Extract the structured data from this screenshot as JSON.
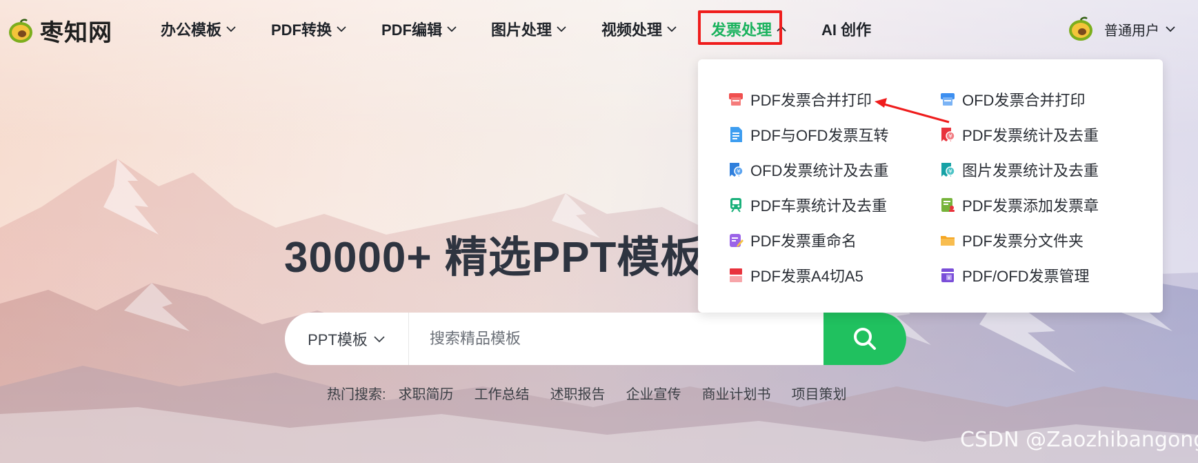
{
  "brand": {
    "name": "枣知网"
  },
  "nav": {
    "items": [
      {
        "label": "办公模板"
      },
      {
        "label": "PDF转换"
      },
      {
        "label": "PDF编辑"
      },
      {
        "label": "图片处理"
      },
      {
        "label": "视频处理"
      },
      {
        "label": "发票处理"
      },
      {
        "label": "AI 创作"
      }
    ]
  },
  "user": {
    "label": "普通用户"
  },
  "dropdown": {
    "left": [
      {
        "label": "PDF发票合并打印",
        "icon": "invoice-print-icon",
        "color": "#f0504f"
      },
      {
        "label": "PDF与OFD发票互转",
        "icon": "invoice-convert-icon",
        "color": "#3d9df0"
      },
      {
        "label": "OFD发票统计及去重",
        "icon": "ofd-dedupe-icon",
        "color": "#2f7fdc"
      },
      {
        "label": "PDF车票统计及去重",
        "icon": "train-ticket-icon",
        "color": "#19b07a"
      },
      {
        "label": "PDF发票重命名",
        "icon": "rename-icon",
        "color": "#9b63e8"
      },
      {
        "label": "PDF发票A4切A5",
        "icon": "a4-cut-icon",
        "color": "#e8323c"
      }
    ],
    "right": [
      {
        "label": "OFD发票合并打印",
        "icon": "ofd-print-icon",
        "color": "#3d8ff0"
      },
      {
        "label": "PDF发票统计及去重",
        "icon": "pdf-dedupe-icon",
        "color": "#e8323c"
      },
      {
        "label": "图片发票统计及去重",
        "icon": "image-dedupe-icon",
        "color": "#16a2a6"
      },
      {
        "label": "PDF发票添加发票章",
        "icon": "stamp-icon",
        "color": "#76b33a"
      },
      {
        "label": "PDF发票分文件夹",
        "icon": "folder-icon",
        "color": "#f5a623"
      },
      {
        "label": "PDF/OFD发票管理",
        "icon": "manage-icon",
        "color": "#7a4ed8"
      }
    ]
  },
  "hero": {
    "title": "30000+ 精选PPT模板",
    "search": {
      "category": "PPT模板",
      "placeholder": "搜索精品模板"
    },
    "hot_label": "热门搜索:",
    "hot_items": [
      "求职简历",
      "工作总结",
      "述职报告",
      "企业宣传",
      "商业计划书",
      "项目策划"
    ]
  },
  "watermark": "CSDN @Zaozhibangong",
  "colors": {
    "accent": "#20c15f",
    "highlight_box": "#ef1c1c",
    "arrow": "#ef1c1c"
  }
}
